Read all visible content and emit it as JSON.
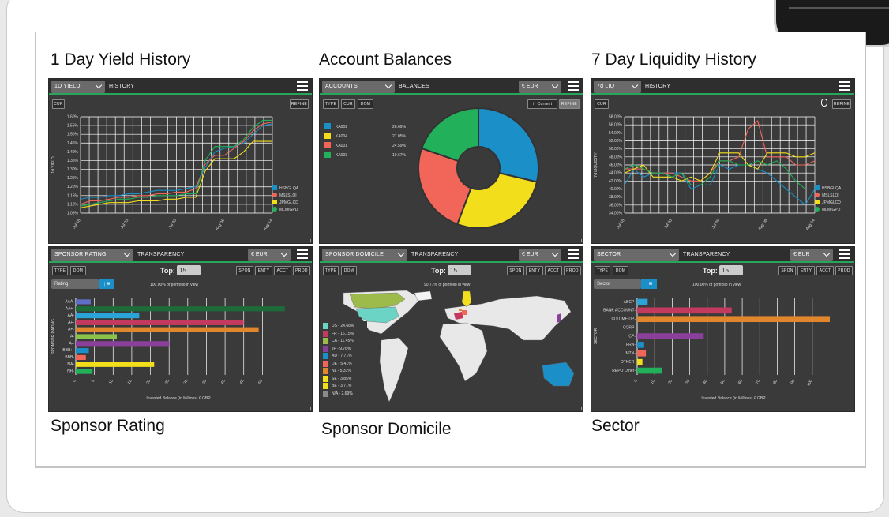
{
  "titles": {
    "p1": "1 Day Yield History",
    "p2": "Account Balances",
    "p3": "7 Day Liquidity History",
    "p4": "Sponsor Rating",
    "p5": "Sponsor Domicile",
    "p6": "Sector"
  },
  "yield": {
    "select": "1D YIELD",
    "label": "HISTORY",
    "cur_button": "CUR",
    "refine_button": "REFINE",
    "ylabel": "1d YIELD",
    "yticks": [
      "1.60%",
      "1.55%",
      "1.50%",
      "1.45%",
      "1.40%",
      "1.35%",
      "1.30%",
      "1.25%",
      "1.20%",
      "1.15%",
      "1.10%",
      "1.05%"
    ],
    "xticks": [
      "Jul 16",
      "Jul 23",
      "Jul 30",
      "Aug 06",
      "Aug 14"
    ],
    "legend": [
      "HSBGLQA",
      "MSLSLQI",
      "JPMGLCD",
      "MLMIGPD"
    ],
    "colors": [
      "#1a8fc8",
      "#f2665a",
      "#f2de1a",
      "#22b05a"
    ]
  },
  "chart_data": [
    {
      "type": "line",
      "title": "1 Day Yield History",
      "ylabel": "1d YIELD",
      "ylim": [
        1.05,
        1.6
      ],
      "x": [
        "Jul 16",
        "Jul 23",
        "Jul 30",
        "Aug 06",
        "Aug 14"
      ],
      "series": [
        {
          "name": "HSBGLQA",
          "values": [
            1.13,
            1.14,
            1.14,
            1.15,
            1.15,
            1.16,
            1.16,
            1.17,
            1.18,
            1.18,
            1.18,
            1.19,
            1.2,
            1.31,
            1.4,
            1.42,
            1.43,
            1.45,
            1.5,
            1.55,
            1.56
          ]
        },
        {
          "name": "MSLSLQI",
          "values": [
            1.1,
            1.12,
            1.12,
            1.13,
            1.14,
            1.14,
            1.15,
            1.15,
            1.16,
            1.16,
            1.17,
            1.17,
            1.19,
            1.33,
            1.38,
            1.38,
            1.42,
            1.46,
            1.52,
            1.56,
            1.57
          ]
        },
        {
          "name": "JPMGLCD",
          "values": [
            1.08,
            1.09,
            1.1,
            1.11,
            1.11,
            1.11,
            1.12,
            1.12,
            1.12,
            1.13,
            1.13,
            1.14,
            1.14,
            1.29,
            1.36,
            1.36,
            1.36,
            1.4,
            1.46,
            1.46,
            1.46
          ]
        },
        {
          "name": "MLMIGPD",
          "values": [
            1.09,
            1.1,
            1.11,
            1.12,
            1.13,
            1.13,
            1.14,
            1.14,
            1.15,
            1.15,
            1.15,
            1.16,
            1.16,
            1.35,
            1.43,
            1.43,
            1.43,
            1.47,
            1.54,
            1.58,
            1.58
          ]
        }
      ]
    },
    {
      "type": "pie",
      "title": "Account Balances",
      "labels": [
        "KA002",
        "KA004",
        "KA001",
        "KA003"
      ],
      "values": [
        28.69,
        27.05,
        24.59,
        19.67
      ]
    },
    {
      "type": "line",
      "title": "7 Day Liquidity History",
      "ylabel": "7d LIQUIDITY",
      "ylim": [
        34,
        58
      ],
      "x": [
        "Jul 16",
        "Jul 23",
        "Jul 30",
        "Aug 06",
        "Aug 14"
      ],
      "series": [
        {
          "name": "HSBGLQA",
          "values": [
            41,
            45,
            43,
            44,
            44,
            44,
            44,
            40,
            41,
            41,
            46,
            45,
            46,
            46,
            45,
            44,
            42,
            40,
            38,
            36,
            40
          ]
        },
        {
          "name": "MSLSLQI",
          "values": [
            45,
            45,
            45,
            44,
            44,
            44,
            43,
            42,
            42,
            44,
            47,
            47,
            48,
            55,
            57,
            48,
            48,
            48,
            46,
            46,
            47
          ]
        },
        {
          "name": "JPMGLCD",
          "values": [
            44,
            45,
            46,
            43,
            43,
            43,
            42,
            43,
            42,
            44,
            49,
            49,
            49,
            46,
            45,
            49,
            49,
            49,
            48,
            48,
            49
          ]
        },
        {
          "name": "MLMIGPD",
          "values": [
            45,
            46,
            45,
            44,
            44,
            43,
            44,
            41,
            41,
            43,
            47,
            47,
            46,
            46,
            47,
            46,
            47,
            45,
            42,
            40,
            40
          ]
        }
      ]
    },
    {
      "type": "bar",
      "title": "Sponsor Rating",
      "ylabel": "SPONSOR RATING",
      "xlabel": "Invested Balance (in Millions) £ GBP",
      "xlim": [
        0,
        55
      ],
      "categories": [
        "AAA",
        "AA+",
        "AA",
        "A+",
        "A+",
        "A",
        "A-",
        "BBB+",
        "BBB",
        "NA",
        "NR"
      ],
      "values": [
        4,
        56,
        17,
        45,
        49,
        11,
        25,
        3.5,
        2.7,
        21,
        4.5
      ],
      "colors": [
        "#5f6fc8",
        "#1e6b3a",
        "#2aa4d8",
        "#c43a5e",
        "#e0872e",
        "#8bc34a",
        "#8a3f9a",
        "#1a8fc8",
        "#f2665a",
        "#f2de1a",
        "#22b05a"
      ]
    },
    {
      "type": "map",
      "title": "Sponsor Domicile",
      "labels": [
        "US",
        "FR",
        "CA",
        "JP",
        "AU",
        "DE",
        "NL",
        "SE",
        "BE",
        "N/A"
      ],
      "values": [
        24.68,
        16.15,
        11.45,
        9.78,
        7.71,
        5.41,
        5.31,
        3.85,
        3.71,
        2.69
      ]
    },
    {
      "type": "bar",
      "title": "Sector",
      "ylabel": "SECTOR",
      "xlabel": "Invested Balance (in Millions) £ GBP",
      "xlim": [
        0,
        110
      ],
      "categories": [
        "ABCP",
        "BANK ACCOUNT",
        "CD/TIME DP",
        "CORP",
        "CP",
        "FRN",
        "MTN",
        "OTHER",
        "REPO Other"
      ],
      "values": [
        6,
        54,
        110,
        0,
        38,
        4,
        5,
        3,
        14
      ],
      "colors": [
        "#2aa4d8",
        "#c43a5e",
        "#e0872e",
        "#8bc34a",
        "#8a3f9a",
        "#1a8fc8",
        "#f2665a",
        "#f2de1a",
        "#22b05a"
      ]
    }
  ],
  "balances": {
    "select": "ACCOUNTS",
    "label": "BALANCES",
    "currency": "€ EUR",
    "type": "TYPE",
    "cur": "CUR",
    "dom": "DOM",
    "current": "Current",
    "refine": "REFINE",
    "legend": [
      {
        "name": "KA002",
        "pct": "28.69%"
      },
      {
        "name": "KA004",
        "pct": "27.05%"
      },
      {
        "name": "KA001",
        "pct": "24.59%"
      },
      {
        "name": "KA003",
        "pct": "19.67%"
      }
    ],
    "colors": [
      "#1a8fc8",
      "#f2de1a",
      "#f2665a",
      "#22b05a"
    ]
  },
  "liquidity": {
    "select": "7d LIQ",
    "label": "HISTORY",
    "cur_button": "CUR",
    "refine_button": "REFINE",
    "ylabel": "7d LIQUIDITY",
    "yticks": [
      "58.00%",
      "56.00%",
      "54.00%",
      "52.00%",
      "50.00%",
      "48.00%",
      "46.00%",
      "44.00%",
      "42.00%",
      "40.00%",
      "38.00%",
      "36.00%",
      "34.00%"
    ],
    "xticks": [
      "Jul 16",
      "Jul 23",
      "Jul 30",
      "Aug 06",
      "Aug 14"
    ],
    "legend": [
      "HSBGLQA",
      "MSLSLQI",
      "JPMGLCD",
      "MLMIGPD"
    ]
  },
  "rating": {
    "select": "SPONSOR RATING",
    "label": "TRANSPARENCY",
    "currency": "€ EUR",
    "type": "TYPE",
    "dom": "DOM",
    "top_label": "Top:",
    "top_value": "15",
    "spon": "SPON",
    "enty": "ENTY",
    "acct": "ACCT",
    "prod": "PROD",
    "sort_select": "Rating",
    "portfolio_note": "100.00% of portfolio in view",
    "xticks": [
      "0",
      "5",
      "10",
      "15",
      "20",
      "25",
      "30",
      "35",
      "40",
      "45",
      "50"
    ]
  },
  "domicile": {
    "select": "SPONSOR DOMICILE",
    "label": "TRANSPARENCY",
    "currency": "€ EUR",
    "type": "TYPE",
    "dom": "DOM",
    "top_label": "Top:",
    "top_value": "15",
    "spon": "SPON",
    "enty": "ENTY",
    "acct": "ACCT",
    "prod": "PROD",
    "portfolio_note": "90.77% of portfolio in view",
    "legend": [
      "US - 24.68%",
      "FR - 16.15%",
      "CA - 11.45%",
      "JP - 9.78%",
      "AU - 7.71%",
      "DE - 5.41%",
      "NL - 5.31%",
      "SE - 3.85%",
      "BE - 3.71%",
      "N/A - 2.69%"
    ],
    "colors": [
      "#6cd4c4",
      "#c43a5e",
      "#9dbb4a",
      "#8a3f9a",
      "#1a8fc8",
      "#f2665a",
      "#e0872e",
      "#f2de1a",
      "#f2de1a",
      "#8a8a8a"
    ]
  },
  "sector": {
    "select": "SECTOR",
    "label": "TRANSPARENCY",
    "currency": "€ EUR",
    "type": "TYPE",
    "dom": "DOM",
    "top_label": "Top:",
    "top_value": "15",
    "spon": "SPON",
    "enty": "ENTY",
    "acct": "ACCT",
    "prod": "PROD",
    "sort_select": "Sector",
    "portfolio_note": "100.00% of portfolio in view",
    "xticks": [
      "0",
      "10",
      "20",
      "30",
      "40",
      "50",
      "60",
      "70",
      "80",
      "90",
      "100"
    ]
  }
}
